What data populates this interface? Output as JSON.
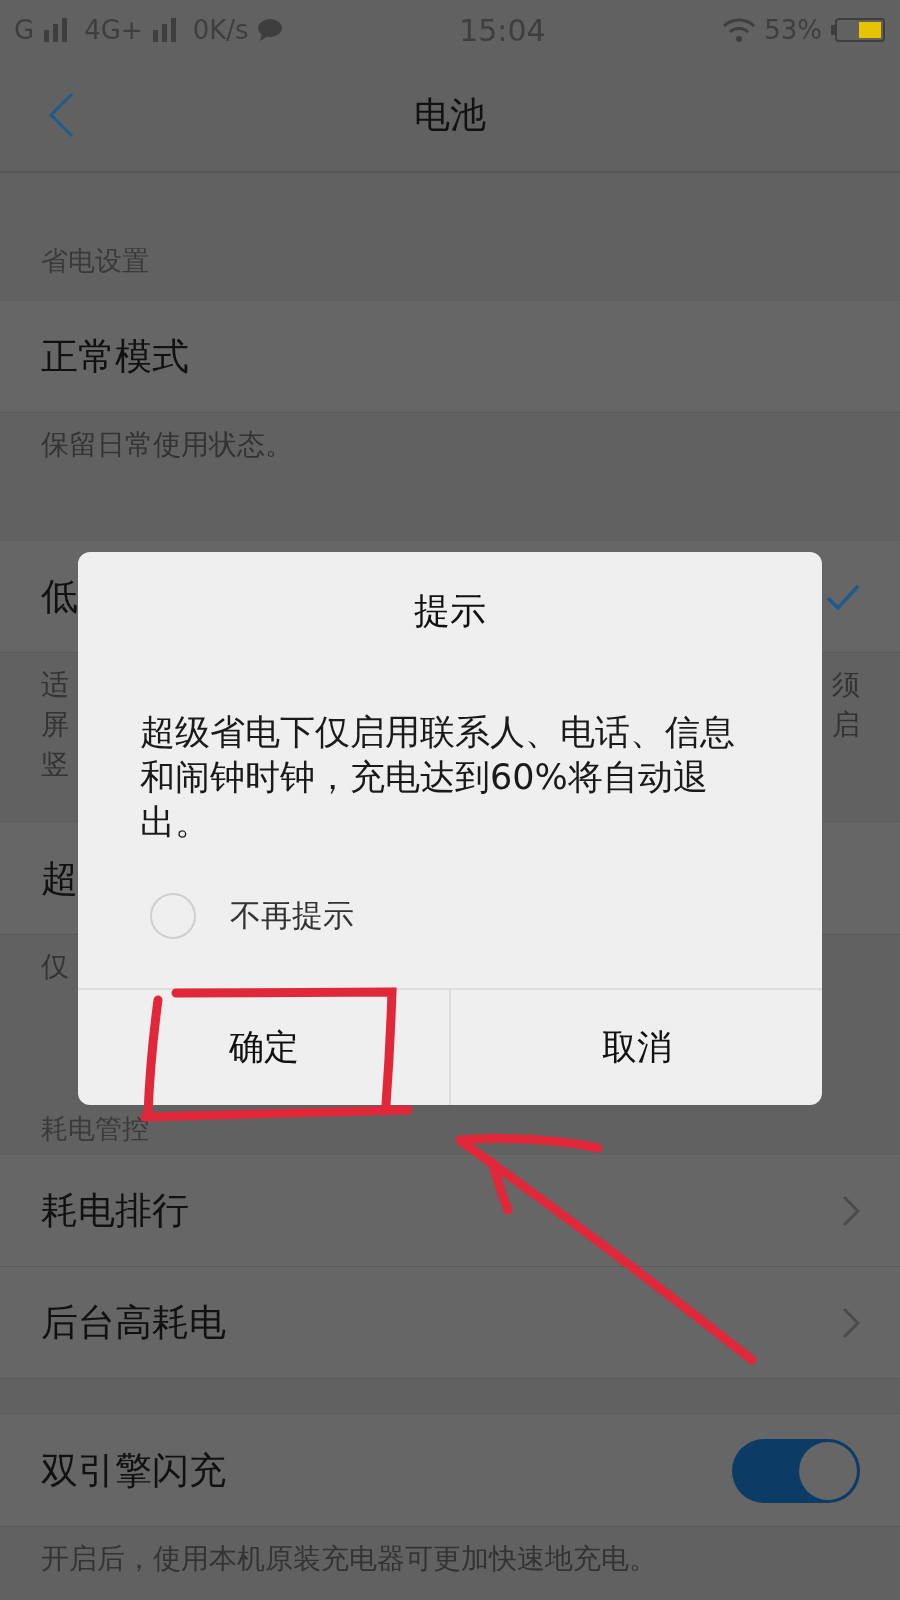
{
  "status_bar": {
    "network_1": "G",
    "network_2": "4G+",
    "speed": "0K/s",
    "time": "15:04",
    "battery": "53%"
  },
  "nav": {
    "title": "电池"
  },
  "rows": [
    {
      "kind": "header",
      "text": "省电设置"
    },
    {
      "kind": "item",
      "title": "正常模式"
    },
    {
      "kind": "desc",
      "lines": [
        {
          "left": "保留日常使用状态。"
        }
      ]
    },
    {
      "kind": "gap"
    },
    {
      "kind": "item",
      "title": "低",
      "checked": true
    },
    {
      "kind": "desc",
      "lines": [
        {
          "left": "适",
          "right": "须"
        },
        {
          "left": "屏",
          "right": "启"
        },
        {
          "left": "竖"
        }
      ]
    },
    {
      "kind": "item",
      "title": "超"
    },
    {
      "kind": "desc",
      "lines": [
        {
          "left": "仅"
        }
      ]
    },
    {
      "kind": "header",
      "text": "耗电管控"
    },
    {
      "kind": "link",
      "title": "耗电排行"
    },
    {
      "kind": "link",
      "title": "后台高耗电"
    },
    {
      "kind": "gap"
    },
    {
      "kind": "switch",
      "title": "双引擎闪充",
      "on": true
    },
    {
      "kind": "desc",
      "lines": [
        {
          "left": "开启后，使用本机原装充电器可更加快速地充电。"
        }
      ]
    }
  ],
  "dialog": {
    "title": "提示",
    "message": "超级省电下仅启用联系人、电话、信息和闹钟时钟，充电达到60%将自动退出。",
    "option": {
      "label": "不再提示",
      "checked": false
    },
    "buttons": [
      {
        "label": "确定"
      },
      {
        "label": "取消"
      }
    ]
  }
}
